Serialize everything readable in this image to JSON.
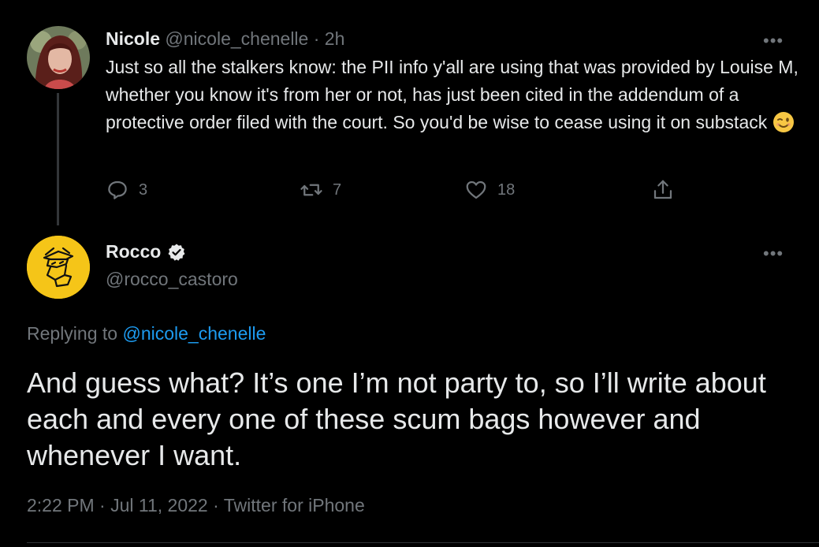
{
  "parent_tweet": {
    "author_name": "Nicole",
    "author_handle": "@nicole_chenelle",
    "separator": "·",
    "time_ago": "2h",
    "text": "Just so all the stalkers know: the PII info y'all are using that was provided by Louise M, whether you know it's from her or not, has just been cited in the addendum of a protective order filed with the court. So you'd be wise to cease using it on substack",
    "emoji_icon": "winking-face-emoji",
    "more_icon": "more-dots-icon",
    "actions": {
      "replies": "3",
      "retweets": "7",
      "likes": "18"
    }
  },
  "reply_tweet": {
    "author_name": "Rocco",
    "verified_icon": "verified-badge-icon",
    "author_handle": "@rocco_castoro",
    "more_icon": "more-dots-icon",
    "replying_prefix": "Replying to",
    "replying_handle": "@nicole_chenelle",
    "text": "And guess what? It’s one I’m not party to, so I’ll write about each and every one of these scum bags however and whenever I want.",
    "time": "2:22 PM",
    "date": "Jul 11, 2022",
    "source": "Twitter for iPhone",
    "separator": "·"
  },
  "colors": {
    "background": "#000000",
    "text": "#e7e9ea",
    "muted": "#71767b",
    "link": "#1d9bf0",
    "avatar_yellow": "#f5c518"
  }
}
